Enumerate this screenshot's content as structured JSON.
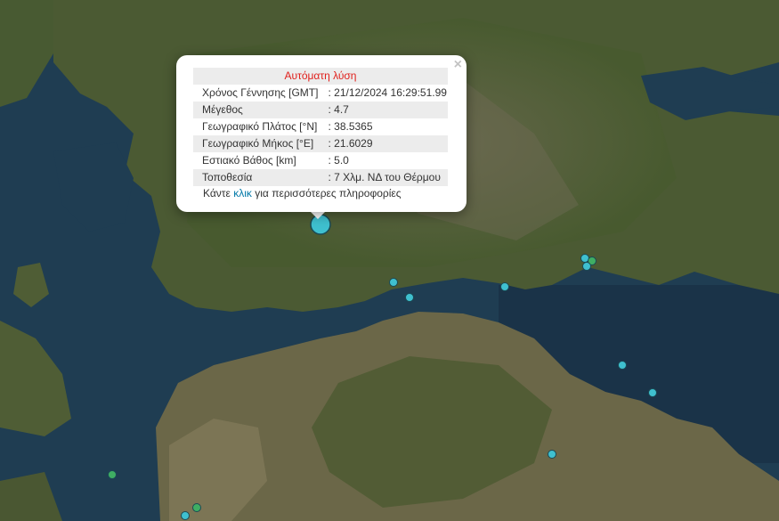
{
  "popup": {
    "title": "Αυτόματη λύση",
    "close_symbol": "×",
    "rows": [
      {
        "label": "Χρόνος Γέννησης [GMT]",
        "value": ": 21/12/2024 16:29:51.99"
      },
      {
        "label": "Μέγεθος",
        "value": ": 4.7"
      },
      {
        "label": "Γεωγραφικό Πλάτος [°N]",
        "value": ": 38.5365"
      },
      {
        "label": "Γεωγραφικό Μήκος [°E]",
        "value": ": 21.6029"
      },
      {
        "label": "Εστιακό Βάθος [km]",
        "value": ": 5.0"
      },
      {
        "label": "Τοποθεσία",
        "value": ": 7 Χλμ. ΝΔ του Θέρμου"
      }
    ],
    "more_prefix": "Κάντε",
    "more_link": "κλικ",
    "more_suffix": "για περισσότερες πληροφορίες"
  },
  "colors": {
    "marker_cyan": "#3fc0cf",
    "marker_green": "#3fae63",
    "sea": "#1d3a4f",
    "land": "#4d5a35"
  },
  "markers": [
    {
      "kind": "main",
      "color": "cyan"
    },
    {
      "kind": "small",
      "color": "cyan"
    },
    {
      "kind": "small",
      "color": "cyan"
    },
    {
      "kind": "small",
      "color": "cyan"
    },
    {
      "kind": "small",
      "color": "cyan"
    },
    {
      "kind": "small",
      "color": "green"
    },
    {
      "kind": "small",
      "color": "cyan"
    },
    {
      "kind": "small",
      "color": "cyan"
    },
    {
      "kind": "small",
      "color": "cyan"
    },
    {
      "kind": "small",
      "color": "cyan"
    },
    {
      "kind": "small",
      "color": "green"
    },
    {
      "kind": "small",
      "color": "green"
    },
    {
      "kind": "small",
      "color": "cyan"
    }
  ]
}
